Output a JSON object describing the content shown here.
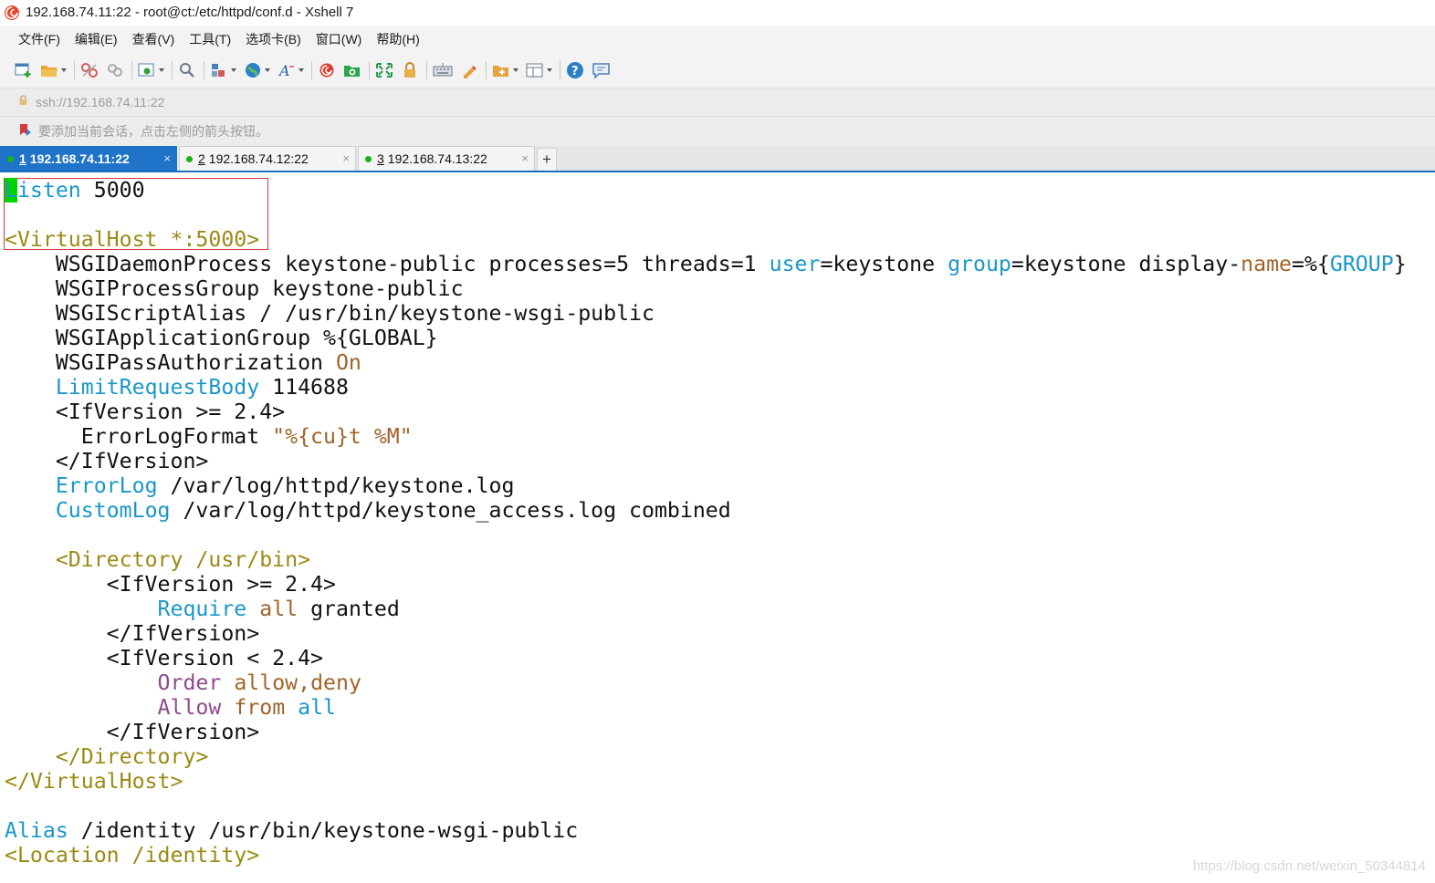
{
  "window": {
    "title": "192.168.74.11:22 - root@ct:/etc/httpd/conf.d - Xshell 7"
  },
  "menu": [
    {
      "label": "文件(F)"
    },
    {
      "label": "编辑(E)"
    },
    {
      "label": "查看(V)"
    },
    {
      "label": "工具(T)"
    },
    {
      "label": "选项卡(B)"
    },
    {
      "label": "窗口(W)"
    },
    {
      "label": "帮助(H)"
    }
  ],
  "toolbar": {
    "icons": [
      "new-session-icon",
      "open-folder-icon",
      "disconnect-icon",
      "reconnect-icon",
      "properties-icon",
      "find-icon",
      "transfer-icon",
      "globe-icon",
      "font-icon",
      "xshell-icon",
      "xftp-icon",
      "fullscreen-icon",
      "lock-icon",
      "keyboard-icon",
      "highlight-icon",
      "script-icon",
      "layout-icon",
      "help-icon",
      "chat-icon"
    ]
  },
  "address": {
    "value": "ssh://192.168.74.11:22"
  },
  "hint": {
    "text": "要添加当前会话，点击左侧的箭头按钮。"
  },
  "tabs": [
    {
      "num": "1",
      "label": "192.168.74.11:22",
      "active": true
    },
    {
      "num": "2",
      "label": "192.168.74.12:22",
      "active": false
    },
    {
      "num": "3",
      "label": "192.168.74.13:22",
      "active": false
    }
  ],
  "terminal": {
    "lines": [
      [
        [
          "L",
          "cursor"
        ],
        [
          "isten",
          "cyan"
        ],
        [
          " 5000",
          "black"
        ]
      ],
      [],
      [
        [
          "<VirtualHost *:5000>",
          "olive"
        ]
      ],
      [
        [
          "    WSGIDaemonProcess keystone-public processes=5 threads=1 ",
          "black"
        ],
        [
          "user",
          "cyan"
        ],
        [
          "=keystone ",
          "black"
        ],
        [
          "group",
          "cyan"
        ],
        [
          "=keystone display-",
          "black"
        ],
        [
          "name",
          "brown"
        ],
        [
          "=%{",
          "black"
        ],
        [
          "GROUP",
          "cyan"
        ],
        [
          "}",
          "black"
        ]
      ],
      [
        [
          "    WSGIProcessGroup keystone-public",
          "black"
        ]
      ],
      [
        [
          "    WSGIScriptAlias / /usr/bin/keystone-wsgi-public",
          "black"
        ]
      ],
      [
        [
          "    WSGIApplicationGroup %{GLOBAL}",
          "black"
        ]
      ],
      [
        [
          "    WSGIPassAuthorization ",
          "black"
        ],
        [
          "On",
          "brown"
        ]
      ],
      [
        [
          "    ",
          "black"
        ],
        [
          "LimitRequestBody",
          "cyan"
        ],
        [
          " 114688",
          "black"
        ]
      ],
      [
        [
          "    <IfVersion >= 2.4>",
          "black"
        ]
      ],
      [
        [
          "      ErrorLogFormat ",
          "black"
        ],
        [
          "\"%{cu}t %M\"",
          "brown"
        ]
      ],
      [
        [
          "    </IfVersion>",
          "black"
        ]
      ],
      [
        [
          "    ",
          "black"
        ],
        [
          "ErrorLog",
          "cyan"
        ],
        [
          " /var/log/httpd/keystone.log",
          "black"
        ]
      ],
      [
        [
          "    ",
          "black"
        ],
        [
          "CustomLog",
          "cyan"
        ],
        [
          " /var/log/httpd/keystone_access.log combined",
          "black"
        ]
      ],
      [],
      [
        [
          "    ",
          "black"
        ],
        [
          "<Directory /usr/bin>",
          "olive"
        ]
      ],
      [
        [
          "        <IfVersion >= 2.4>",
          "black"
        ]
      ],
      [
        [
          "            ",
          "black"
        ],
        [
          "Require",
          "cyan"
        ],
        [
          " ",
          "black"
        ],
        [
          "all",
          "brown"
        ],
        [
          " granted",
          "black"
        ]
      ],
      [
        [
          "        </IfVersion>",
          "black"
        ]
      ],
      [
        [
          "        <IfVersion < 2.4>",
          "black"
        ]
      ],
      [
        [
          "            ",
          "black"
        ],
        [
          "Order",
          "purple"
        ],
        [
          " ",
          "black"
        ],
        [
          "allow,deny",
          "brown"
        ]
      ],
      [
        [
          "            ",
          "black"
        ],
        [
          "Allow",
          "purple"
        ],
        [
          " ",
          "black"
        ],
        [
          "from",
          "brown"
        ],
        [
          " ",
          "black"
        ],
        [
          "all",
          "cyan"
        ]
      ],
      [
        [
          "        </IfVersion>",
          "black"
        ]
      ],
      [
        [
          "    ",
          "black"
        ],
        [
          "</Directory>",
          "olive"
        ]
      ],
      [
        [
          "</VirtualHost>",
          "olive"
        ]
      ],
      [],
      [
        [
          "Alias",
          "cyan"
        ],
        [
          " /identity /usr/bin/keystone-wsgi-public",
          "black"
        ]
      ],
      [
        [
          "<Location /identity>",
          "olive"
        ]
      ]
    ]
  },
  "watermark": "https://blog.csdn.net/weixin_50344814",
  "colors": {
    "cyan": "#1a97c8",
    "olive": "#9a8a14",
    "brown": "#a0642a",
    "purple": "#8e4a8a",
    "cursor": "#00d400",
    "active_tab": "#1f73c8",
    "highlight_box": "#cf3b3b"
  }
}
